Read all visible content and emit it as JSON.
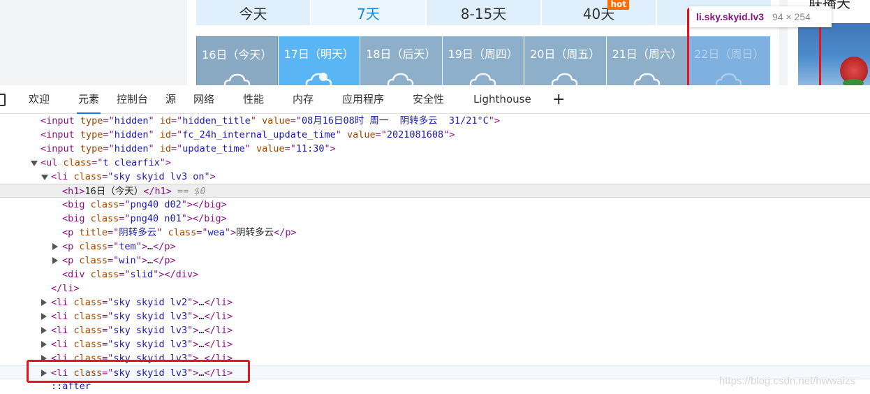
{
  "web": {
    "range_tabs": [
      {
        "label": "今天",
        "active": false
      },
      {
        "label": "7天",
        "active": true
      },
      {
        "label": "8-15天",
        "active": false
      },
      {
        "label": "40天",
        "active": false,
        "badge": "hot"
      },
      {
        "label": "",
        "active": false
      }
    ],
    "days": [
      {
        "label": "16日（今天）",
        "state": "today",
        "icon": "cloud-icon"
      },
      {
        "label": "17日（明天）",
        "state": "tomorrow",
        "icon": "sun-cloud-icon"
      },
      {
        "label": "18日（后天）",
        "state": "normal",
        "icon": "cloud-icon"
      },
      {
        "label": "19日（周四）",
        "state": "normal",
        "icon": "cloud-icon"
      },
      {
        "label": "20日（周五）",
        "state": "normal",
        "icon": "cloud-icon"
      },
      {
        "label": "21日（周六）",
        "state": "normal",
        "icon": "cloud-icon"
      },
      {
        "label": "22日（周日）",
        "state": "highlighted",
        "icon": "cloud-icon"
      }
    ],
    "side_title": "联播天",
    "tooltip": {
      "name": "li.sky.skyid.lv3",
      "size": "94 × 254"
    }
  },
  "devtools": {
    "tabs": [
      "欢迎",
      "元素",
      "控制台",
      "源",
      "网络",
      "性能",
      "内存",
      "应用程序",
      "安全性",
      "Lighthouse"
    ],
    "active_tab": "元素",
    "plus": "+",
    "lines": [
      {
        "indent": 0,
        "toggle": "none",
        "parts": [
          [
            "tag",
            "<input "
          ],
          [
            "attr",
            "type"
          ],
          [
            "tag",
            "=\""
          ],
          [
            "val",
            "hidden"
          ],
          [
            "tag",
            "\" "
          ],
          [
            "attr",
            "id"
          ],
          [
            "tag",
            "=\""
          ],
          [
            "val",
            "hidden_title"
          ],
          [
            "tag",
            "\" "
          ],
          [
            "attr",
            "value"
          ],
          [
            "tag",
            "=\""
          ],
          [
            "val",
            "08月16日08时 周一  阴转多云  31/21°C"
          ],
          [
            "tag",
            "\">"
          ]
        ]
      },
      {
        "indent": 0,
        "toggle": "none",
        "parts": [
          [
            "tag",
            "<input "
          ],
          [
            "attr",
            "type"
          ],
          [
            "tag",
            "=\""
          ],
          [
            "val",
            "hidden"
          ],
          [
            "tag",
            "\" "
          ],
          [
            "attr",
            "id"
          ],
          [
            "tag",
            "=\""
          ],
          [
            "val",
            "fc_24h_internal_update_time"
          ],
          [
            "tag",
            "\" "
          ],
          [
            "attr",
            "value"
          ],
          [
            "tag",
            "=\""
          ],
          [
            "val",
            "2021081608"
          ],
          [
            "tag",
            "\">"
          ]
        ]
      },
      {
        "indent": 0,
        "toggle": "none",
        "parts": [
          [
            "tag",
            "<input "
          ],
          [
            "attr",
            "type"
          ],
          [
            "tag",
            "=\""
          ],
          [
            "val",
            "hidden"
          ],
          [
            "tag",
            "\" "
          ],
          [
            "attr",
            "id"
          ],
          [
            "tag",
            "=\""
          ],
          [
            "val",
            "update_time"
          ],
          [
            "tag",
            "\" "
          ],
          [
            "attr",
            "value"
          ],
          [
            "tag",
            "=\""
          ],
          [
            "val",
            "11:30"
          ],
          [
            "tag",
            "\">"
          ]
        ]
      },
      {
        "indent": 0,
        "toggle": "down",
        "parts": [
          [
            "tag",
            "<ul "
          ],
          [
            "attr",
            "class"
          ],
          [
            "tag",
            "=\""
          ],
          [
            "val",
            "t clearfix"
          ],
          [
            "tag",
            "\">"
          ]
        ]
      },
      {
        "indent": 1,
        "toggle": "down",
        "parts": [
          [
            "tag",
            "<li "
          ],
          [
            "attr",
            "class"
          ],
          [
            "tag",
            "=\""
          ],
          [
            "val",
            "sky skyid lv3 on"
          ],
          [
            "tag",
            "\">"
          ]
        ]
      },
      {
        "indent": 2,
        "toggle": "none",
        "state": "selected",
        "parts": [
          [
            "tag",
            "<h1>"
          ],
          [
            "txt",
            "16日（今天）"
          ],
          [
            "tag",
            "</h1>"
          ],
          [
            "eq",
            " == $0"
          ]
        ]
      },
      {
        "indent": 2,
        "toggle": "none",
        "parts": [
          [
            "tag",
            "<big "
          ],
          [
            "attr",
            "class"
          ],
          [
            "tag",
            "=\""
          ],
          [
            "val",
            "png40 d02"
          ],
          [
            "tag",
            "\"></big>"
          ]
        ]
      },
      {
        "indent": 2,
        "toggle": "none",
        "parts": [
          [
            "tag",
            "<big "
          ],
          [
            "attr",
            "class"
          ],
          [
            "tag",
            "=\""
          ],
          [
            "val",
            "png40 n01"
          ],
          [
            "tag",
            "\"></big>"
          ]
        ]
      },
      {
        "indent": 2,
        "toggle": "none",
        "parts": [
          [
            "tag",
            "<p "
          ],
          [
            "attr",
            "title"
          ],
          [
            "tag",
            "=\""
          ],
          [
            "val",
            "阴转多云"
          ],
          [
            "tag",
            "\" "
          ],
          [
            "attr",
            "class"
          ],
          [
            "tag",
            "=\""
          ],
          [
            "val",
            "wea"
          ],
          [
            "tag",
            "\">"
          ],
          [
            "txt",
            "阴转多云"
          ],
          [
            "tag",
            "</p>"
          ]
        ]
      },
      {
        "indent": 2,
        "toggle": "right",
        "parts": [
          [
            "tag",
            "<p "
          ],
          [
            "attr",
            "class"
          ],
          [
            "tag",
            "=\""
          ],
          [
            "val",
            "tem"
          ],
          [
            "tag",
            "\">"
          ],
          [
            "txt",
            "…"
          ],
          [
            "tag",
            "</p>"
          ]
        ]
      },
      {
        "indent": 2,
        "toggle": "right",
        "parts": [
          [
            "tag",
            "<p "
          ],
          [
            "attr",
            "class"
          ],
          [
            "tag",
            "=\""
          ],
          [
            "val",
            "win"
          ],
          [
            "tag",
            "\">"
          ],
          [
            "txt",
            "…"
          ],
          [
            "tag",
            "</p>"
          ]
        ]
      },
      {
        "indent": 2,
        "toggle": "none",
        "parts": [
          [
            "tag",
            "<div "
          ],
          [
            "attr",
            "class"
          ],
          [
            "tag",
            "=\""
          ],
          [
            "val",
            "slid"
          ],
          [
            "tag",
            "\"></div>"
          ]
        ]
      },
      {
        "indent": 1,
        "toggle": "none",
        "parts": [
          [
            "tag",
            "</li>"
          ]
        ]
      },
      {
        "indent": 1,
        "toggle": "right",
        "parts": [
          [
            "tag",
            "<li "
          ],
          [
            "attr",
            "class"
          ],
          [
            "tag",
            "=\""
          ],
          [
            "val",
            "sky skyid lv2"
          ],
          [
            "tag",
            "\">"
          ],
          [
            "txt",
            "…"
          ],
          [
            "tag",
            "</li>"
          ]
        ]
      },
      {
        "indent": 1,
        "toggle": "right",
        "parts": [
          [
            "tag",
            "<li "
          ],
          [
            "attr",
            "class"
          ],
          [
            "tag",
            "=\""
          ],
          [
            "val",
            "sky skyid lv3"
          ],
          [
            "tag",
            "\">"
          ],
          [
            "txt",
            "…"
          ],
          [
            "tag",
            "</li>"
          ]
        ]
      },
      {
        "indent": 1,
        "toggle": "right",
        "parts": [
          [
            "tag",
            "<li "
          ],
          [
            "attr",
            "class"
          ],
          [
            "tag",
            "=\""
          ],
          [
            "val",
            "sky skyid lv3"
          ],
          [
            "tag",
            "\">"
          ],
          [
            "txt",
            "…"
          ],
          [
            "tag",
            "</li>"
          ]
        ]
      },
      {
        "indent": 1,
        "toggle": "right",
        "parts": [
          [
            "tag",
            "<li "
          ],
          [
            "attr",
            "class"
          ],
          [
            "tag",
            "=\""
          ],
          [
            "val",
            "sky skyid lv3"
          ],
          [
            "tag",
            "\">"
          ],
          [
            "txt",
            "…"
          ],
          [
            "tag",
            "</li>"
          ]
        ]
      },
      {
        "indent": 1,
        "toggle": "right",
        "parts": [
          [
            "tag",
            "<li "
          ],
          [
            "attr",
            "class"
          ],
          [
            "tag",
            "=\""
          ],
          [
            "val",
            "sky skyid lv3"
          ],
          [
            "tag",
            "\">"
          ],
          [
            "txt",
            "…"
          ],
          [
            "tag",
            "</li>"
          ]
        ]
      },
      {
        "indent": 1,
        "toggle": "right",
        "state": "hover",
        "parts": [
          [
            "tag",
            "<li "
          ],
          [
            "attr",
            "class"
          ],
          [
            "tag",
            "=\""
          ],
          [
            "val",
            "sky skyid lv3"
          ],
          [
            "tag",
            "\">"
          ],
          [
            "txt",
            "…"
          ],
          [
            "tag",
            "</li>"
          ]
        ]
      },
      {
        "indent": 1,
        "toggle": "none",
        "parts": [
          [
            "val",
            "::after"
          ]
        ]
      }
    ],
    "watermark": "https://blog.csdn.net/hwwaizs"
  }
}
